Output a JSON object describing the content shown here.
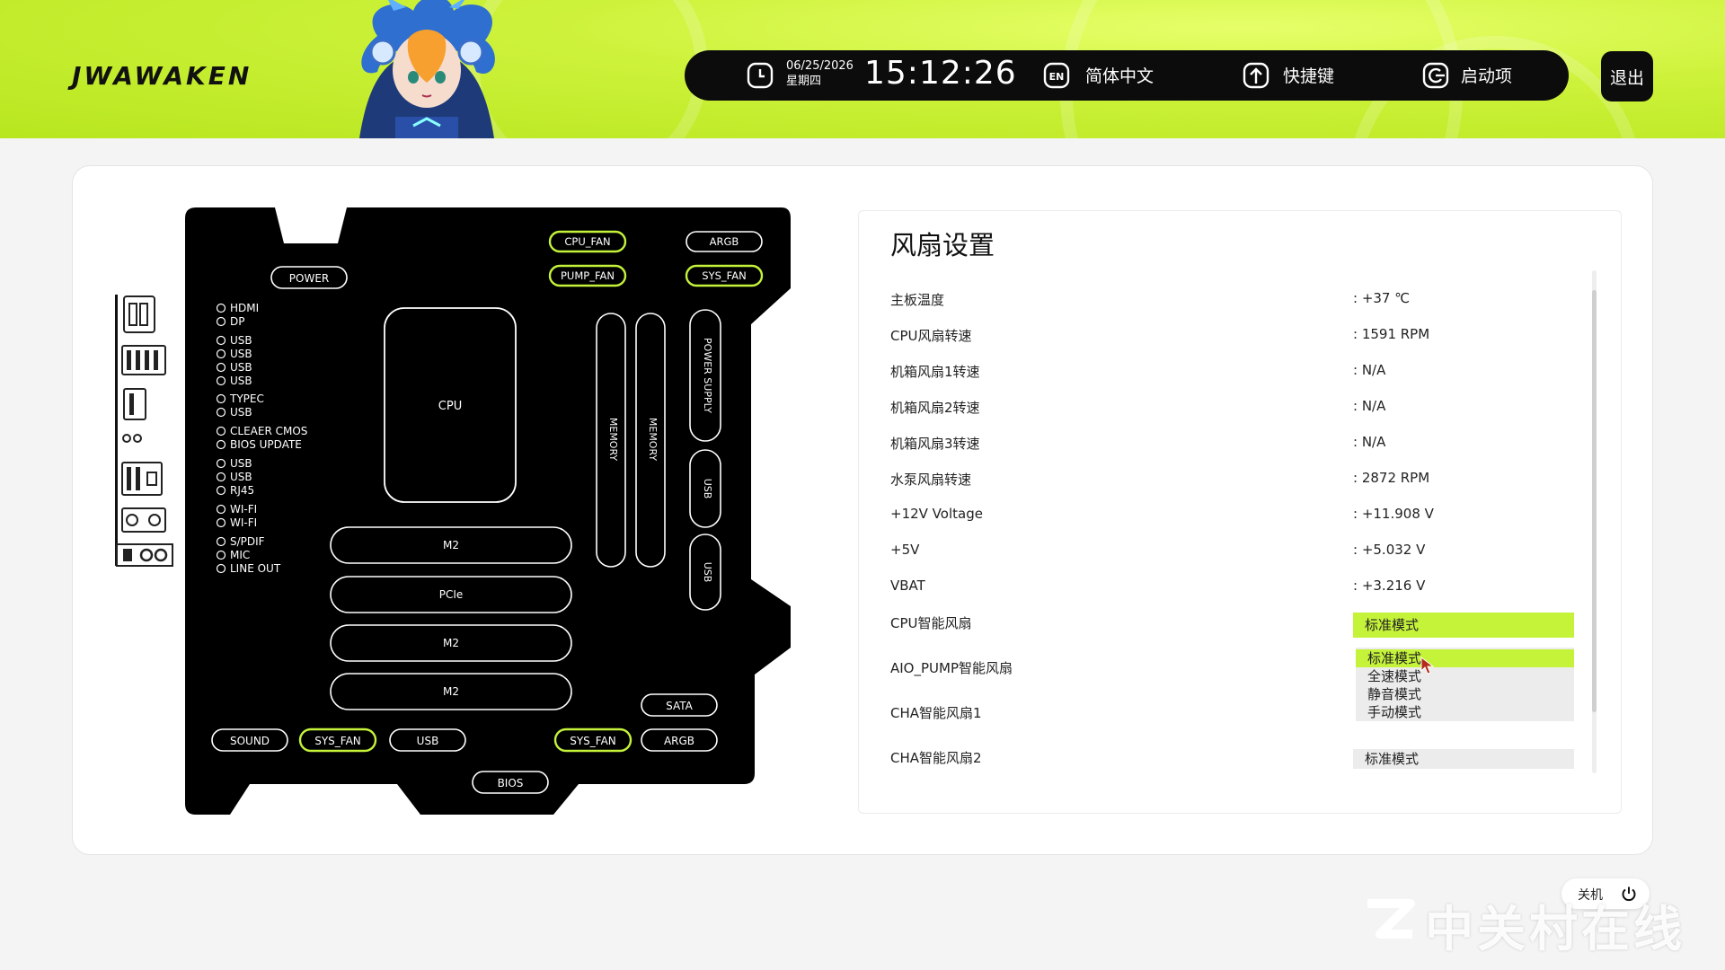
{
  "header": {
    "logo": "JWAWAKEN",
    "date": "06/25/2026",
    "weekday": "星期四",
    "time": "15:12:26",
    "language_badge": "EN",
    "language": "简体中文",
    "shortcuts": "快捷键",
    "boot": "启动项",
    "exit": "退出"
  },
  "motherboard": {
    "rear_io_labels": [
      "HDMI",
      "DP",
      "USB",
      "USB",
      "USB",
      "USB",
      "TYPEC",
      "USB",
      "CLEAER CMOS",
      "BIOS UPDATE",
      "USB",
      "USB",
      "RJ45",
      "WI-FI",
      "WI-FI",
      "S/PDIF",
      "MIC",
      "LINE OUT"
    ],
    "power": "POWER",
    "cpu": "CPU",
    "cpu_fan": "CPU_FAN",
    "pump_fan": "PUMP_FAN",
    "argb_top": "ARGB",
    "sys_fan_top": "SYS_FAN",
    "memory_1": "MEMORY",
    "memory_2": "MEMORY",
    "power_supply": "POWER SUPPLY",
    "usb_1": "USB",
    "usb_2": "USB",
    "m2_1": "M2",
    "pcie": "PCIe",
    "m2_2": "M2",
    "m2_3": "M2",
    "sata": "SATA",
    "sound": "SOUND",
    "sys_fan_b1": "SYS_FAN",
    "usb_bottom": "USB",
    "sys_fan_b2": "SYS_FAN",
    "argb_bottom": "ARGB",
    "bios": "BIOS",
    "highlight_color": "#c4f33a"
  },
  "fan_settings": {
    "title": "风扇设置",
    "rows": [
      {
        "label": "主板温度",
        "value": ": +37 ℃"
      },
      {
        "label": "CPU风扇转速",
        "value": ": 1591 RPM"
      },
      {
        "label": "机箱风扇1转速",
        "value": ": N/A"
      },
      {
        "label": "机箱风扇2转速",
        "value": ": N/A"
      },
      {
        "label": "机箱风扇3转速",
        "value": ": N/A"
      },
      {
        "label": "水泵风扇转速",
        "value": ": 2872 RPM"
      },
      {
        "label": "+12V Voltage",
        "value": ": +11.908 V"
      },
      {
        "label": "+5V",
        "value": ": +5.032 V"
      },
      {
        "label": "VBAT",
        "value": ": +3.216 V"
      }
    ],
    "cpu_smart_fan": {
      "label": "CPU智能风扇",
      "selected": "标准模式"
    },
    "aio_pump_fan": {
      "label": "AIO_PUMP智能风扇"
    },
    "cha_fan_1": {
      "label": "CHA智能风扇1"
    },
    "cha_fan_2": {
      "label": "CHA智能风扇2",
      "selected": "标准模式"
    },
    "dropdown_options": [
      "标准模式",
      "全速模式",
      "静音模式",
      "手动模式"
    ]
  },
  "footer": {
    "shutdown": "关机",
    "watermark": "中关村在线"
  }
}
